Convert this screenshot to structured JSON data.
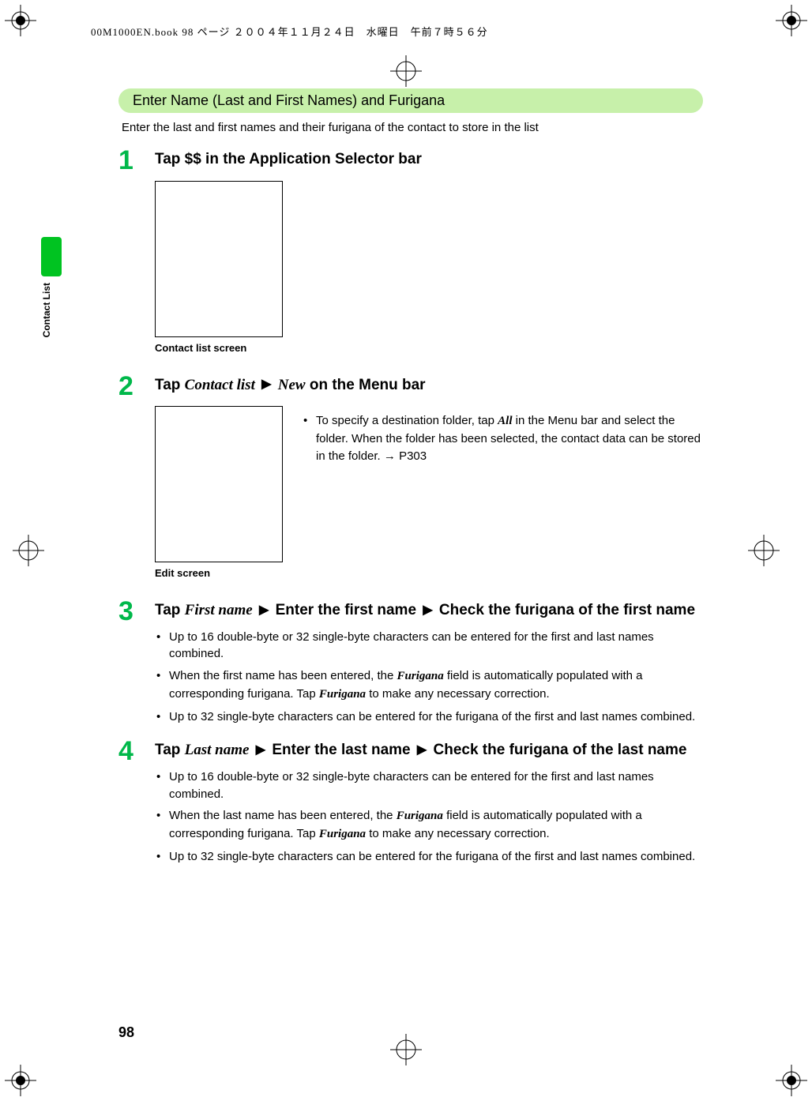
{
  "header_note": "00M1000EN.book  98 ページ  ２００４年１１月２４日　水曜日　午前７時５６分",
  "side_tab": {
    "label": "Contact List"
  },
  "page_number": "98",
  "section_title": "Enter Name (Last and First Names) and Furigana",
  "intro": "Enter the last and first names and their furigana of the contact to store in the list",
  "arrow_glyph": "▶",
  "rarrow": "→",
  "steps": {
    "s1": {
      "num": "1",
      "title": "Tap $$ in the Application Selector bar",
      "caption": "Contact list screen"
    },
    "s2": {
      "num": "2",
      "title_pre": "Tap ",
      "title_it_1": "Contact list",
      "title_mid": " ",
      "title_it_2": "New",
      "title_post": " on the Menu bar",
      "note_pre": "To specify a destination folder, tap ",
      "note_it": "All",
      "note_post": " in the Menu bar and select the folder. When the folder has been selected, the contact data can be stored in the folder. ",
      "note_xref": "P303",
      "caption": "Edit screen"
    },
    "s3": {
      "num": "3",
      "t_pre": "Tap ",
      "t_it_1": "First name",
      "t_mid1": " Enter the first name ",
      "t_mid2": " Check the furigana of the first name",
      "b1": "Up to 16 double-byte or 32 single-byte characters can be entered for the first and last names combined.",
      "b2_pre": "When the first name has been entered, the ",
      "b2_it1": "Furigana",
      "b2_mid": " field is automatically populated with a corresponding furigana. Tap ",
      "b2_it2": "Furigana",
      "b2_post": " to make any necessary correction.",
      "b3": "Up to 32 single-byte characters can be entered for the furigana of the first and last names combined."
    },
    "s4": {
      "num": "4",
      "t_pre": "Tap ",
      "t_it_1": "Last name",
      "t_mid1": " Enter the last name ",
      "t_mid2": " Check the furigana of the last name",
      "b1": "Up to 16 double-byte or 32 single-byte characters can be entered for the first and last names combined.",
      "b2_pre": "When the last name has been entered, the ",
      "b2_it1": "Furigana",
      "b2_mid": " field is automatically populated with a corresponding furigana. Tap ",
      "b2_it2": "Furigana",
      "b2_post": " to make any necessary correction.",
      "b3": "Up to 32 single-byte characters can be entered for the furigana of the first and last names combined."
    }
  }
}
